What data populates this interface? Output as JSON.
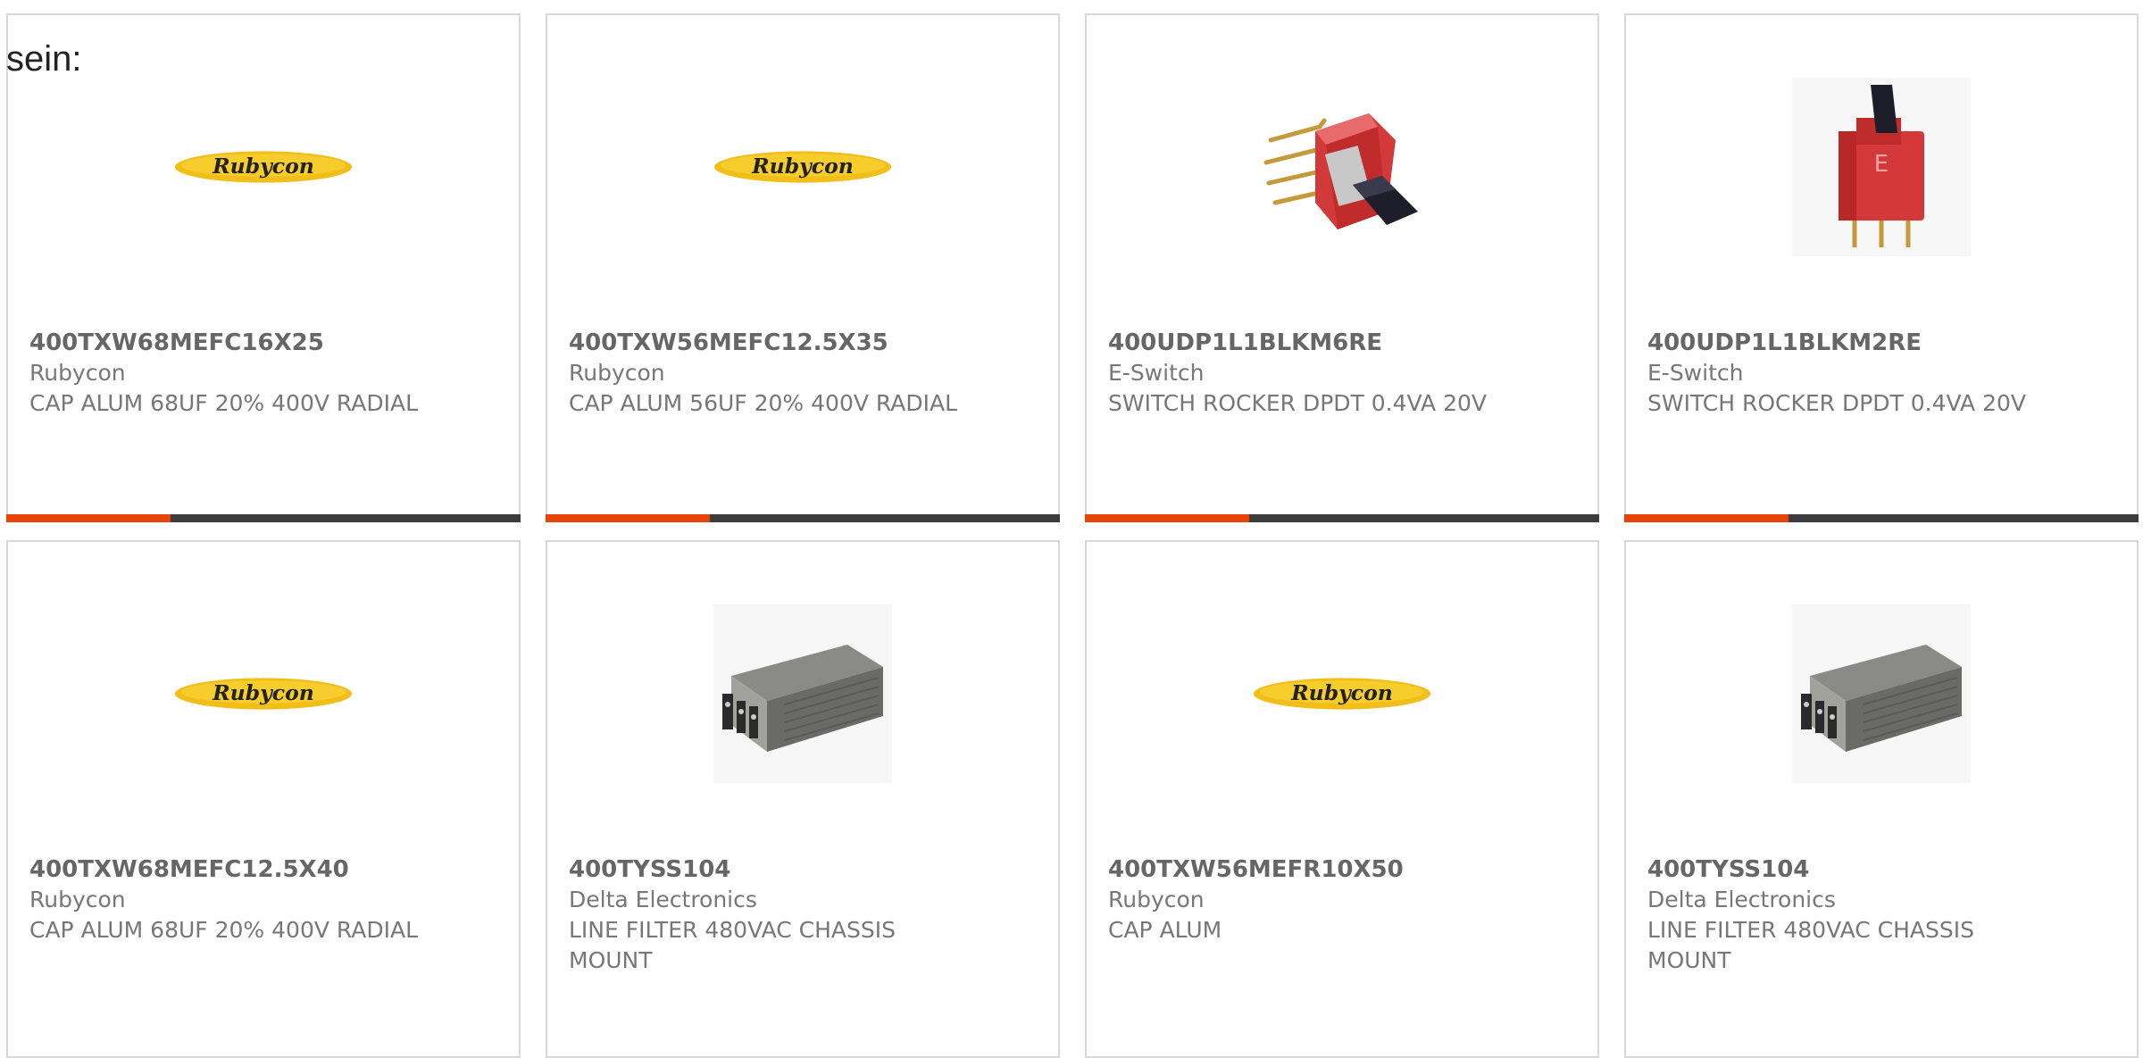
{
  "page": {
    "label": "sein:"
  },
  "colors": {
    "accent": "#e8440a",
    "bar": "#3c3c3c",
    "border": "#d8d8d8",
    "text": "#777777"
  },
  "products": [
    {
      "part_number": "400TXW68MEFC16X25",
      "manufacturer": "Rubycon",
      "description": "CAP ALUM 68UF 20% 400V RADIAL",
      "image": "rubycon-logo",
      "progress": 0.32
    },
    {
      "part_number": "400TXW56MEFC12.5X35",
      "manufacturer": "Rubycon",
      "description": "CAP ALUM 56UF 20% 400V RADIAL",
      "image": "rubycon-logo",
      "progress": 0.32
    },
    {
      "part_number": "400UDP1L1BLKM6RE",
      "manufacturer": "E-Switch",
      "description": "SWITCH ROCKER DPDT 0.4VA 20V",
      "image": "rocker-switch-right-angle",
      "progress": 0.32
    },
    {
      "part_number": "400UDP1L1BLKM2RE",
      "manufacturer": "E-Switch",
      "description": "SWITCH ROCKER DPDT 0.4VA 20V",
      "image": "rocker-switch-vertical",
      "image_text": "E",
      "progress": 0.32
    },
    {
      "part_number": "400TXW68MEFC12.5X40",
      "manufacturer": "Rubycon",
      "description": "CAP ALUM 68UF 20% 400V RADIAL",
      "image": "rubycon-logo"
    },
    {
      "part_number": "400TYSS104",
      "manufacturer": "Delta Electronics",
      "description": "LINE FILTER 480VAC CHASSIS MOUNT",
      "image": "line-filter"
    },
    {
      "part_number": "400TXW56MEFR10X50",
      "manufacturer": "Rubycon",
      "description": "CAP ALUM",
      "image": "rubycon-logo"
    },
    {
      "part_number": "400TYSS104",
      "manufacturer": "Delta Electronics",
      "description": "LINE FILTER 480VAC CHASSIS MOUNT",
      "image": "line-filter"
    }
  ]
}
